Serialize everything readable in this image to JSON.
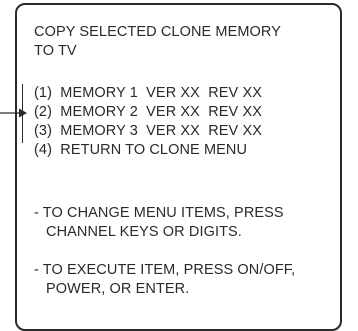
{
  "screen": {
    "title_line1": "COPY SELECTED CLONE MEMORY",
    "title_line2": "TO TV",
    "menu_items": [
      "(1)  MEMORY 1  VER XX  REV XX",
      "(2)  MEMORY 2  VER XX  REV XX",
      "(3)  MEMORY 3  VER XX  REV XX",
      "(4)  RETURN TO CLONE MENU"
    ],
    "instructions": [
      {
        "line1": "- TO CHANGE MENU ITEMS, PRESS",
        "line2": "CHANNEL KEYS OR DIGITS."
      },
      {
        "line1": "- TO EXECUTE ITEM, PRESS ON/OFF,",
        "line2": "POWER, OR ENTER."
      }
    ]
  },
  "colors": {
    "ink": "#2a2a2a",
    "background": "#ffffff"
  },
  "icons": {
    "pointer": "arrow-right-icon"
  }
}
